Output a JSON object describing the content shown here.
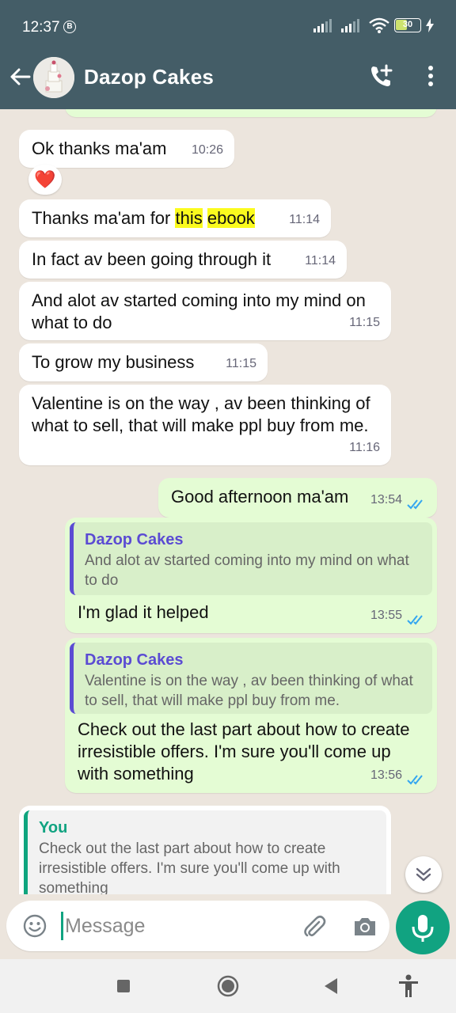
{
  "status_bar": {
    "time": "12:37",
    "b_badge": "B",
    "battery": "30"
  },
  "header": {
    "title": "Dazop Cakes"
  },
  "messages": [
    {
      "text": "Ok thanks ma'am",
      "time": "10:26",
      "reaction": "❤️"
    },
    {
      "text_before": "Thanks ma'am for ",
      "hl1": "this",
      "hl2": "ebook",
      "time": "11:14"
    },
    {
      "text": "In fact av been going through it",
      "time": "11:14"
    },
    {
      "text": "And alot av started coming into my mind on what to do",
      "time": "11:15"
    },
    {
      "text": "To grow my business",
      "time": "11:15"
    },
    {
      "text": "Valentine is on the way , av been thinking of what to sell, that will make ppl buy from me.",
      "time": "11:16"
    },
    {
      "text": "Good afternoon ma'am",
      "time": "13:54"
    },
    {
      "quote_author": "Dazop Cakes",
      "quote_text": "And alot av started coming into my mind on what to do",
      "text": "I'm glad it helped",
      "time": "13:55"
    },
    {
      "quote_author": "Dazop Cakes",
      "quote_text": "Valentine is on the way , av been thinking of what to sell, that will make ppl buy from me.",
      "text": "Check out the last part about how to create irresistible offers. I'm sure you'll come up with something",
      "time": "13:56"
    },
    {
      "quote_author": "You",
      "quote_text": "Check out the last part about how to create irresistible offers. I'm sure you'll come up with something"
    }
  ],
  "composer": {
    "placeholder": "Message"
  },
  "colors": {
    "header": "#445d67",
    "accent": "#11a381",
    "outgoing": "#e4fcd4",
    "highlight": "#fbfb1e",
    "quote_author": "#5b4bd3"
  },
  "icons": [
    "back-arrow-icon",
    "add-call-icon",
    "more-vert-icon",
    "emoji-icon",
    "attach-icon",
    "camera-icon",
    "mic-icon",
    "chevron-double-down-icon",
    "recents-icon",
    "home-icon",
    "back-icon",
    "accessibility-icon"
  ]
}
